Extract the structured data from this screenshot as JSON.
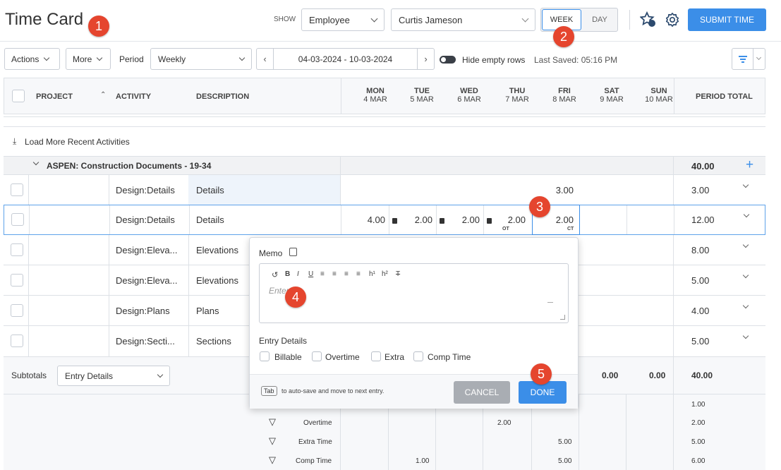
{
  "header": {
    "title": "Time Card",
    "show_label": "SHOW",
    "show_select": "Employee",
    "employee_select": "Curtis Jameson",
    "week_btn": "WEEK",
    "day_btn": "DAY",
    "submit_btn": "SUBMIT TIME"
  },
  "toolbar": {
    "actions": "Actions",
    "more": "More",
    "period_label": "Period",
    "period_select": "Weekly",
    "date_range": "04-03-2024 - 10-03-2024",
    "hide_empty": "Hide empty rows",
    "last_saved": "Last Saved: 05:16 PM"
  },
  "columns": {
    "project": "PROJECT",
    "activity": "ACTIVITY",
    "description": "DESCRIPTION",
    "days": [
      {
        "dow": "MON",
        "date": "4 MAR"
      },
      {
        "dow": "TUE",
        "date": "5 MAR"
      },
      {
        "dow": "WED",
        "date": "6 MAR"
      },
      {
        "dow": "THU",
        "date": "7 MAR"
      },
      {
        "dow": "FRI",
        "date": "8 MAR"
      },
      {
        "dow": "SAT",
        "date": "9 MAR"
      },
      {
        "dow": "SUN",
        "date": "10 MAR"
      }
    ],
    "period_total": "PERIOD TOTAL"
  },
  "load_more": "Load More Recent Activities",
  "group": {
    "title": "ASPEN: Construction Documents - 19-34",
    "total": "40.00"
  },
  "rows": [
    {
      "activity": "Design:Details",
      "description": "Details",
      "fri": "3.00",
      "total": "3.00"
    },
    {
      "activity": "Design:Details",
      "description": "Details",
      "mon": "4.00",
      "tue": "2.00",
      "wed": "2.00",
      "thu": "2.00",
      "thu_tag": "OT",
      "fri": "2.00",
      "fri_tag": "CT",
      "total": "12.00"
    },
    {
      "activity": "Design:Eleva...",
      "description": "Elevations",
      "total": "8.00"
    },
    {
      "activity": "Design:Eleva...",
      "description": "Elevations",
      "total": "5.00"
    },
    {
      "activity": "Design:Plans",
      "description": "Plans",
      "total": "4.00"
    },
    {
      "activity": "Design:Secti...",
      "description": "Sections",
      "total": "5.00"
    }
  ],
  "subtotals": {
    "label": "Subtotals",
    "select": "Entry Details",
    "sat": "0.00",
    "sun": "0.00",
    "total": "40.00"
  },
  "breakdown": [
    {
      "label": "",
      "thu": "",
      "fri": "",
      "tue": "",
      "total": "1.00"
    },
    {
      "label": "Overtime",
      "thu": "2.00",
      "fri": "",
      "tue": "",
      "total": "2.00"
    },
    {
      "label": "Extra Time",
      "thu": "",
      "fri": "5.00",
      "tue": "",
      "total": "5.00"
    },
    {
      "label": "Comp Time",
      "thu": "",
      "fri": "5.00",
      "tue": "1.00",
      "total": "6.00"
    }
  ],
  "popup": {
    "memo_title": "Memo",
    "placeholder": "Enter",
    "entry_details": "Entry Details",
    "billable": "Billable",
    "overtime": "Overtime",
    "extra": "Extra",
    "comp_time": "Comp Time",
    "tab_key": "Tab",
    "tab_hint": "to auto-save and move to next entry.",
    "cancel": "CANCEL",
    "done": "DONE"
  },
  "badges": [
    "1",
    "2",
    "3",
    "4",
    "5"
  ],
  "colors": {
    "accent": "#3b8ee8",
    "badge": "#e5452e"
  }
}
